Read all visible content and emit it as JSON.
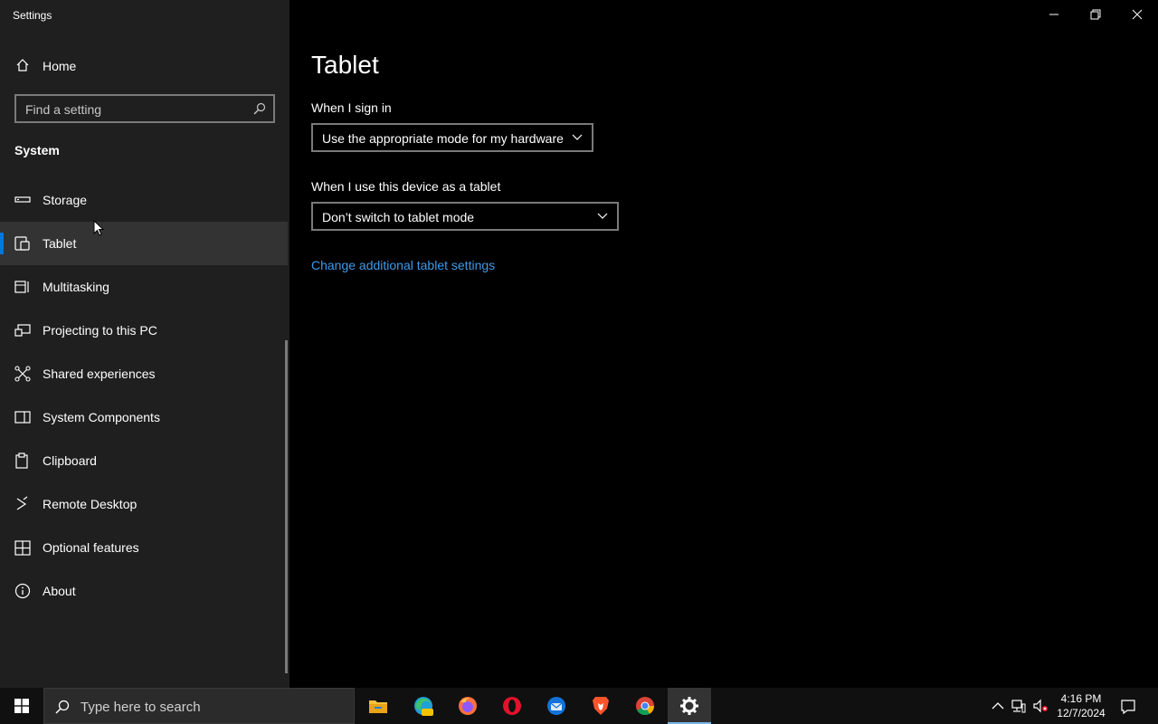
{
  "window": {
    "app_title": "Settings",
    "controls": {
      "minimize": "minimize",
      "restore": "restore",
      "close": "close"
    }
  },
  "sidebar": {
    "home_label": "Home",
    "search_placeholder": "Find a setting",
    "section_title": "System",
    "items": [
      {
        "label": "Storage",
        "icon": "storage-icon",
        "selected": false
      },
      {
        "label": "Tablet",
        "icon": "tablet-icon",
        "selected": true
      },
      {
        "label": "Multitasking",
        "icon": "multitasking-icon",
        "selected": false
      },
      {
        "label": "Projecting to this PC",
        "icon": "projecting-icon",
        "selected": false
      },
      {
        "label": "Shared experiences",
        "icon": "shared-experiences-icon",
        "selected": false
      },
      {
        "label": "System Components",
        "icon": "system-components-icon",
        "selected": false
      },
      {
        "label": "Clipboard",
        "icon": "clipboard-icon",
        "selected": false
      },
      {
        "label": "Remote Desktop",
        "icon": "remote-desktop-icon",
        "selected": false
      },
      {
        "label": "Optional features",
        "icon": "optional-features-icon",
        "selected": false
      },
      {
        "label": "About",
        "icon": "about-icon",
        "selected": false
      }
    ]
  },
  "content": {
    "title": "Tablet",
    "signin_label": "When I sign in",
    "signin_value": "Use the appropriate mode for my hardware",
    "tablet_label": "When I use this device as a tablet",
    "tablet_value": "Don’t switch to tablet mode",
    "link": "Change additional tablet settings"
  },
  "taskbar": {
    "search_placeholder": "Type here to search",
    "apps": [
      "file-explorer-icon",
      "edge-canary-icon",
      "firefox-icon",
      "opera-icon",
      "thunderbird-icon",
      "brave-icon",
      "chrome-icon",
      "settings-icon"
    ],
    "time": "4:16 PM",
    "date": "12/7/2024"
  },
  "colors": {
    "accent": "#0078d7",
    "link": "#3f9ae8",
    "sidebar_bg": "#1f1f1f",
    "content_bg": "#000000",
    "selected_bg": "#333333"
  }
}
